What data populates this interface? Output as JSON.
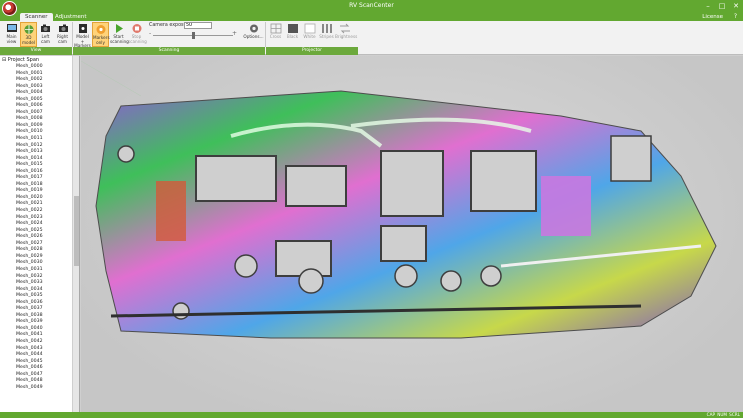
{
  "window": {
    "title": "RV ScanCenter"
  },
  "tabs": [
    {
      "label": "Scanner",
      "active": true
    },
    {
      "label": "Adjustment",
      "active": false
    }
  ],
  "header": {
    "license_label": "License"
  },
  "ribbon": {
    "groups": [
      {
        "label": "View"
      },
      {
        "label": "Scanning"
      },
      {
        "label": "Projector"
      }
    ],
    "view_buttons": [
      {
        "label": "Main view",
        "icon": "main-view-icon",
        "active": false
      },
      {
        "label": "3D model",
        "icon": "3d-model-icon",
        "active": true
      },
      {
        "label": "Left cam",
        "icon": "camera-icon",
        "active": false
      },
      {
        "label": "Right cam",
        "icon": "camera-icon",
        "active": false
      }
    ],
    "scan_buttons": [
      {
        "label": "Model + Markers",
        "icon": "model-markers-icon",
        "active": false
      },
      {
        "label": "Markers only",
        "icon": "markers-only-icon",
        "active": true
      },
      {
        "label": "Start scanning",
        "icon": "play-icon",
        "active": false
      },
      {
        "label": "Stop scanning",
        "icon": "stop-icon",
        "active": false,
        "disabled": true
      }
    ],
    "exposure": {
      "label": "Camera exposure:",
      "value": "50",
      "level": 0.5
    },
    "options_label": "Options...",
    "projector_buttons": [
      {
        "label": "Cross",
        "icon": "cross-icon"
      },
      {
        "label": "Black",
        "icon": "black-icon"
      },
      {
        "label": "White",
        "icon": "white-icon"
      },
      {
        "label": "Stripes",
        "icon": "stripes-icon"
      },
      {
        "label": "Brightness",
        "icon": "brightness-icon"
      }
    ]
  },
  "tree": {
    "root": "Project Span",
    "items": [
      "Mesh_0000",
      "Mesh_0001",
      "Mesh_0002",
      "Mesh_0003",
      "Mesh_0004",
      "Mesh_0005",
      "Mesh_0006",
      "Mesh_0007",
      "Mesh_0008",
      "Mesh_0009",
      "Mesh_0010",
      "Mesh_0011",
      "Mesh_0012",
      "Mesh_0013",
      "Mesh_0014",
      "Mesh_0015",
      "Mesh_0016",
      "Mesh_0017",
      "Mesh_0018",
      "Mesh_0019",
      "Mesh_0020",
      "Mesh_0021",
      "Mesh_0022",
      "Mesh_0023",
      "Mesh_0024",
      "Mesh_0025",
      "Mesh_0026",
      "Mesh_0027",
      "Mesh_0028",
      "Mesh_0029",
      "Mesh_0030",
      "Mesh_0031",
      "Mesh_0032",
      "Mesh_0033",
      "Mesh_0034",
      "Mesh_0035",
      "Mesh_0036",
      "Mesh_0037",
      "Mesh_0038",
      "Mesh_0039",
      "Mesh_0040",
      "Mesh_0041",
      "Mesh_0042",
      "Mesh_0043",
      "Mesh_0044",
      "Mesh_0045",
      "Mesh_0046",
      "Mesh_0047",
      "Mesh_0048",
      "Mesh_0049"
    ]
  },
  "status": {
    "caps": "CAP",
    "num": "NUM",
    "scroll": "SCRL"
  },
  "colors": {
    "accent_green": "#62a830",
    "ribbon_bg": "#f2f2f2",
    "active_button": "#ffd37a",
    "viewport_bg": "#cfcfcf"
  }
}
